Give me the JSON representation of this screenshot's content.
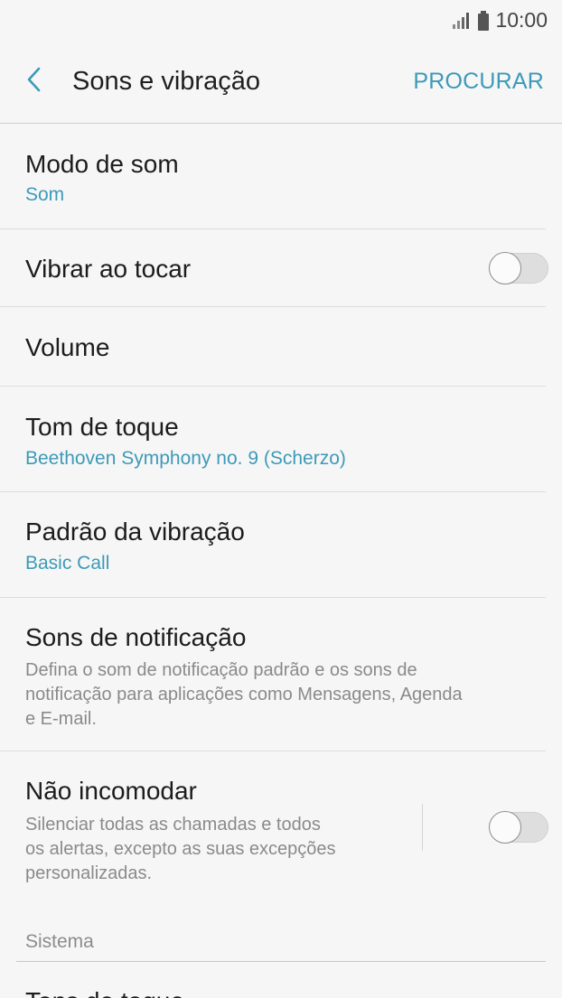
{
  "status_bar": {
    "time": "10:00",
    "icons": [
      "signal-icon",
      "battery-icon"
    ]
  },
  "header": {
    "title": "Sons e vibração",
    "search_label": "PROCURAR",
    "back_icon": "chevron-left-icon"
  },
  "items": {
    "sound_mode": {
      "title": "Modo de som",
      "value": "Som"
    },
    "vibrate_on_touch": {
      "title": "Vibrar ao tocar",
      "enabled": false
    },
    "volume": {
      "title": "Volume"
    },
    "ringtone": {
      "title": "Tom de toque",
      "value": "Beethoven Symphony no. 9 (Scherzo)"
    },
    "vibration_pattern": {
      "title": "Padrão da vibração",
      "value": "Basic Call"
    },
    "notification_sounds": {
      "title": "Sons de notificação",
      "desc_line1": "Defina o som de notificação padrão e os sons de",
      "desc_line2": "notificação para aplicações como Mensagens, Agenda",
      "desc_line3": "e E-mail."
    },
    "do_not_disturb": {
      "title": "Não incomodar",
      "desc_line1": "Silenciar todas as chamadas e todos",
      "desc_line2": "os alertas, excepto as suas excepções",
      "desc_line3": "personalizadas.",
      "enabled": false
    }
  },
  "section": {
    "system_label": "Sistema"
  },
  "next_item_partial": {
    "title": "Tons de toque"
  },
  "colors": {
    "accent": "#3d9ab8",
    "background": "#f6f6f6",
    "divider": "#dcdcdc"
  }
}
